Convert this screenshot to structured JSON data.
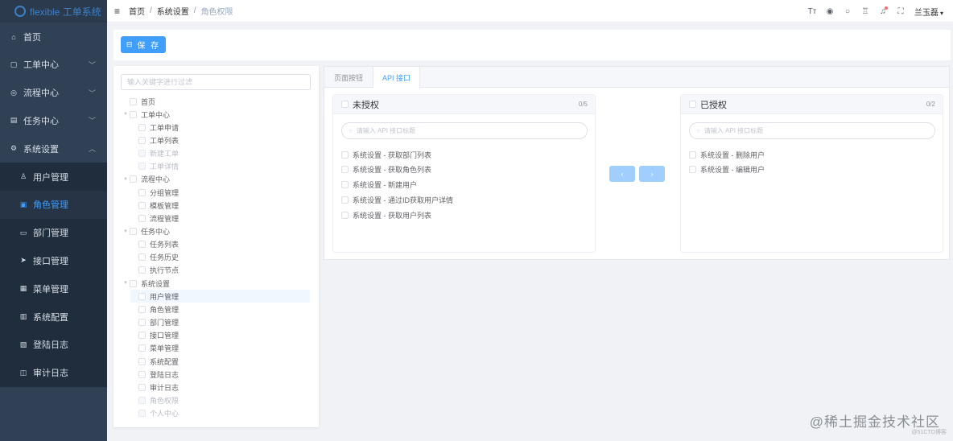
{
  "app": {
    "title": "flexible 工单系统"
  },
  "sidebar": {
    "items": [
      {
        "label": "首页",
        "icon": "home-icon",
        "glyph": "⌂",
        "has_arrow": false,
        "arrow": "",
        "level": "top",
        "active": false
      },
      {
        "label": "工单中心",
        "icon": "ticket-icon",
        "glyph": "▢",
        "has_arrow": true,
        "arrow": "﹀",
        "level": "top",
        "active": false
      },
      {
        "label": "流程中心",
        "icon": "flow-icon",
        "glyph": "◎",
        "has_arrow": true,
        "arrow": "﹀",
        "level": "top",
        "active": false
      },
      {
        "label": "任务中心",
        "icon": "task-icon",
        "glyph": "▤",
        "has_arrow": true,
        "arrow": "﹀",
        "level": "top",
        "active": false
      },
      {
        "label": "系统设置",
        "icon": "settings-icon",
        "glyph": "⚙",
        "has_arrow": true,
        "arrow": "︿",
        "level": "top",
        "active": false
      },
      {
        "label": "用户管理",
        "icon": "user-icon",
        "glyph": "♙",
        "has_arrow": false,
        "arrow": "",
        "level": "sub",
        "active": false
      },
      {
        "label": "角色管理",
        "icon": "role-icon",
        "glyph": "▣",
        "has_arrow": false,
        "arrow": "",
        "level": "sub",
        "active": true
      },
      {
        "label": "部门管理",
        "icon": "dept-icon",
        "glyph": "▭",
        "has_arrow": false,
        "arrow": "",
        "level": "sub",
        "active": false
      },
      {
        "label": "接口管理",
        "icon": "send-icon",
        "glyph": "➤",
        "has_arrow": false,
        "arrow": "",
        "level": "sub",
        "active": false
      },
      {
        "label": "菜单管理",
        "icon": "menu-icon",
        "glyph": "▦",
        "has_arrow": false,
        "arrow": "",
        "level": "sub",
        "active": false
      },
      {
        "label": "系统配置",
        "icon": "config-icon",
        "glyph": "▥",
        "has_arrow": false,
        "arrow": "",
        "level": "sub",
        "active": false
      },
      {
        "label": "登陆日志",
        "icon": "log-icon",
        "glyph": "▧",
        "has_arrow": false,
        "arrow": "",
        "level": "sub",
        "active": false
      },
      {
        "label": "审计日志",
        "icon": "audit-icon",
        "glyph": "◫",
        "has_arrow": false,
        "arrow": "",
        "level": "sub",
        "active": false
      }
    ]
  },
  "navbar": {
    "hamburger": "≡",
    "breadcrumb": [
      "首页",
      "系统设置",
      "角色权限"
    ],
    "separator": "/",
    "icons": [
      {
        "name": "font-size-icon",
        "glyph": "Tт",
        "badge": false
      },
      {
        "name": "github-icon",
        "glyph": "◉",
        "badge": false
      },
      {
        "name": "search-icon",
        "glyph": "○",
        "badge": false
      },
      {
        "name": "theme-icon",
        "glyph": "♖",
        "badge": false
      },
      {
        "name": "bell-icon",
        "glyph": "♫",
        "badge": true
      },
      {
        "name": "fullscreen-icon",
        "glyph": "⛶",
        "badge": false
      }
    ],
    "user": "兰玉磊",
    "user_caret": "▾"
  },
  "toolbar": {
    "save_label": "保 存",
    "save_icon": "⊟"
  },
  "tree": {
    "filter_placeholder": "输入关键字进行过滤",
    "nodes": [
      {
        "label": "首页",
        "depth": 0,
        "toggle": "",
        "disabled": false,
        "highlight": false
      },
      {
        "label": "工单中心",
        "depth": 0,
        "toggle": "▼",
        "disabled": false,
        "highlight": false
      },
      {
        "label": "工单申请",
        "depth": 1,
        "toggle": "",
        "disabled": false,
        "highlight": false
      },
      {
        "label": "工单列表",
        "depth": 1,
        "toggle": "",
        "disabled": false,
        "highlight": false
      },
      {
        "label": "新建工单",
        "depth": 1,
        "toggle": "",
        "disabled": true,
        "highlight": false
      },
      {
        "label": "工单详情",
        "depth": 1,
        "toggle": "",
        "disabled": true,
        "highlight": false
      },
      {
        "label": "流程中心",
        "depth": 0,
        "toggle": "▼",
        "disabled": false,
        "highlight": false
      },
      {
        "label": "分组管理",
        "depth": 1,
        "toggle": "",
        "disabled": false,
        "highlight": false
      },
      {
        "label": "模板管理",
        "depth": 1,
        "toggle": "",
        "disabled": false,
        "highlight": false
      },
      {
        "label": "流程管理",
        "depth": 1,
        "toggle": "",
        "disabled": false,
        "highlight": false
      },
      {
        "label": "任务中心",
        "depth": 0,
        "toggle": "▼",
        "disabled": false,
        "highlight": false
      },
      {
        "label": "任务列表",
        "depth": 1,
        "toggle": "",
        "disabled": false,
        "highlight": false
      },
      {
        "label": "任务历史",
        "depth": 1,
        "toggle": "",
        "disabled": false,
        "highlight": false
      },
      {
        "label": "执行节点",
        "depth": 1,
        "toggle": "",
        "disabled": false,
        "highlight": false
      },
      {
        "label": "系统设置",
        "depth": 0,
        "toggle": "▼",
        "disabled": false,
        "highlight": false
      },
      {
        "label": "用户管理",
        "depth": 1,
        "toggle": "",
        "disabled": false,
        "highlight": true
      },
      {
        "label": "角色管理",
        "depth": 1,
        "toggle": "",
        "disabled": false,
        "highlight": false
      },
      {
        "label": "部门管理",
        "depth": 1,
        "toggle": "",
        "disabled": false,
        "highlight": false
      },
      {
        "label": "接口管理",
        "depth": 1,
        "toggle": "",
        "disabled": false,
        "highlight": false
      },
      {
        "label": "菜单管理",
        "depth": 1,
        "toggle": "",
        "disabled": false,
        "highlight": false
      },
      {
        "label": "系统配置",
        "depth": 1,
        "toggle": "",
        "disabled": false,
        "highlight": false
      },
      {
        "label": "登陆日志",
        "depth": 1,
        "toggle": "",
        "disabled": false,
        "highlight": false
      },
      {
        "label": "审计日志",
        "depth": 1,
        "toggle": "",
        "disabled": false,
        "highlight": false
      },
      {
        "label": "角色权限",
        "depth": 1,
        "toggle": "",
        "disabled": true,
        "highlight": false
      },
      {
        "label": "个人中心",
        "depth": 1,
        "toggle": "",
        "disabled": true,
        "highlight": false
      }
    ]
  },
  "tabs": [
    {
      "label": "页面按钮",
      "active": false
    },
    {
      "label": "API 接口",
      "active": true
    }
  ],
  "transfer": {
    "left": {
      "title": "未授权",
      "count": "0/5",
      "placeholder": "请输入 API 接口标题",
      "items": [
        "系统设置 - 获取部门列表",
        "系统设置 - 获取角色列表",
        "系统设置 - 新建用户",
        "系统设置 - 通过ID获取用户详情",
        "系统设置 - 获取用户列表"
      ]
    },
    "right": {
      "title": "已授权",
      "count": "0/2",
      "placeholder": "请输入 API 接口标题",
      "items": [
        "系统设置 - 删除用户",
        "系统设置 - 编辑用户"
      ]
    },
    "to_left": "‹",
    "to_right": "›"
  },
  "watermark": {
    "main": "@稀土掘金技术社区",
    "sub": "@51CTO博客"
  },
  "colors": {
    "primary": "#409eff",
    "sidebar_bg": "#304156",
    "disabled_button": "#a0cfff"
  }
}
